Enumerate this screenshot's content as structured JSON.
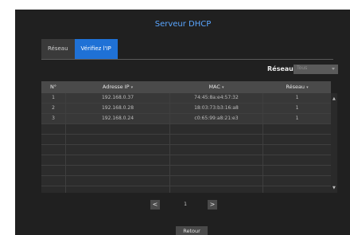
{
  "dialog": {
    "title": "Serveur DHCP",
    "tabs": [
      {
        "label": "Réseau",
        "active": false
      },
      {
        "label": "Vérifiez l'IP",
        "active": true
      }
    ],
    "filter": {
      "label": "Réseau",
      "value": "Tous"
    },
    "table": {
      "columns": [
        "N°",
        "Adresse IP",
        "MAC",
        "Réseau"
      ],
      "rows": [
        {
          "no": "1",
          "ip": "192.168.0.37",
          "mac": "74:45:8a:e4:57:32",
          "network": "1"
        },
        {
          "no": "2",
          "ip": "192.168.0.28",
          "mac": "18:03:73:b3:16:a8",
          "network": "1"
        },
        {
          "no": "3",
          "ip": "192.168.0.24",
          "mac": "c0:65:99:a8:21:e3",
          "network": "1"
        }
      ]
    },
    "pager": {
      "prev": "<",
      "current": "1",
      "next": ">"
    },
    "footer": {
      "back_label": "Retour"
    },
    "colors": {
      "accent": "#1f71d6",
      "title": "#5aa6ff",
      "background": "#202020"
    }
  }
}
